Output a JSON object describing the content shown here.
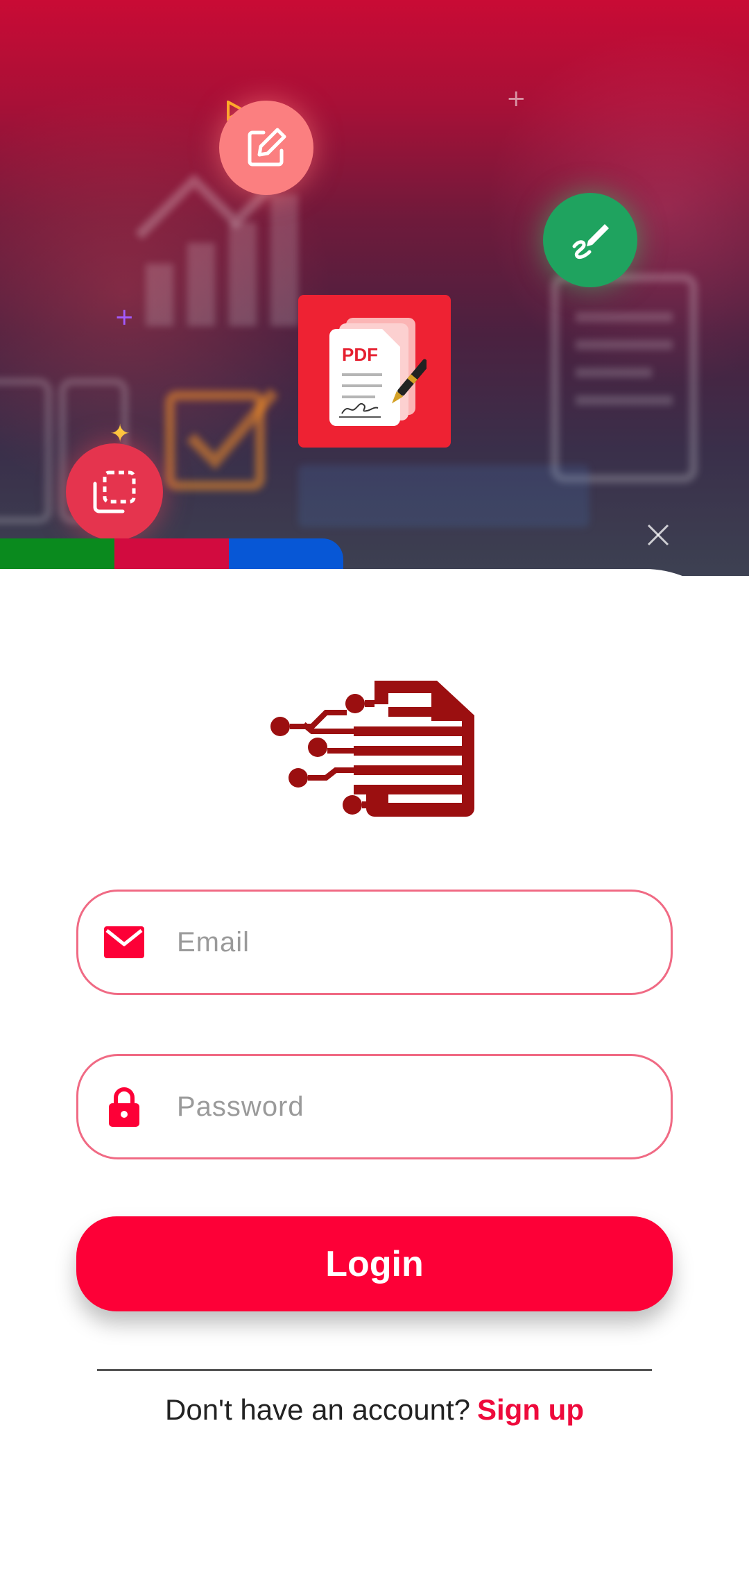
{
  "hero": {
    "app_tile": {
      "label": "PDF"
    },
    "colors": {
      "strip_green": "#0a8a1e",
      "strip_red": "#d20b3f",
      "strip_blue": "#0757d6",
      "edit_circle": "#fb7f80",
      "sign_circle": "#1fa35f",
      "select_circle": "#e5344e",
      "tile": "#ee2233"
    },
    "icons": [
      "edit-icon",
      "signature-icon",
      "select-icon",
      "close-icon",
      "pdf-document-icon"
    ]
  },
  "login": {
    "email_placeholder": "Email",
    "password_placeholder": "Password",
    "button_label": "Login",
    "signup_prompt": "Don't have an account?",
    "signup_link": "Sign up"
  },
  "theme": {
    "accent": "#fd0037",
    "field_border": "#f06a84",
    "logo": "#9b0f10"
  }
}
